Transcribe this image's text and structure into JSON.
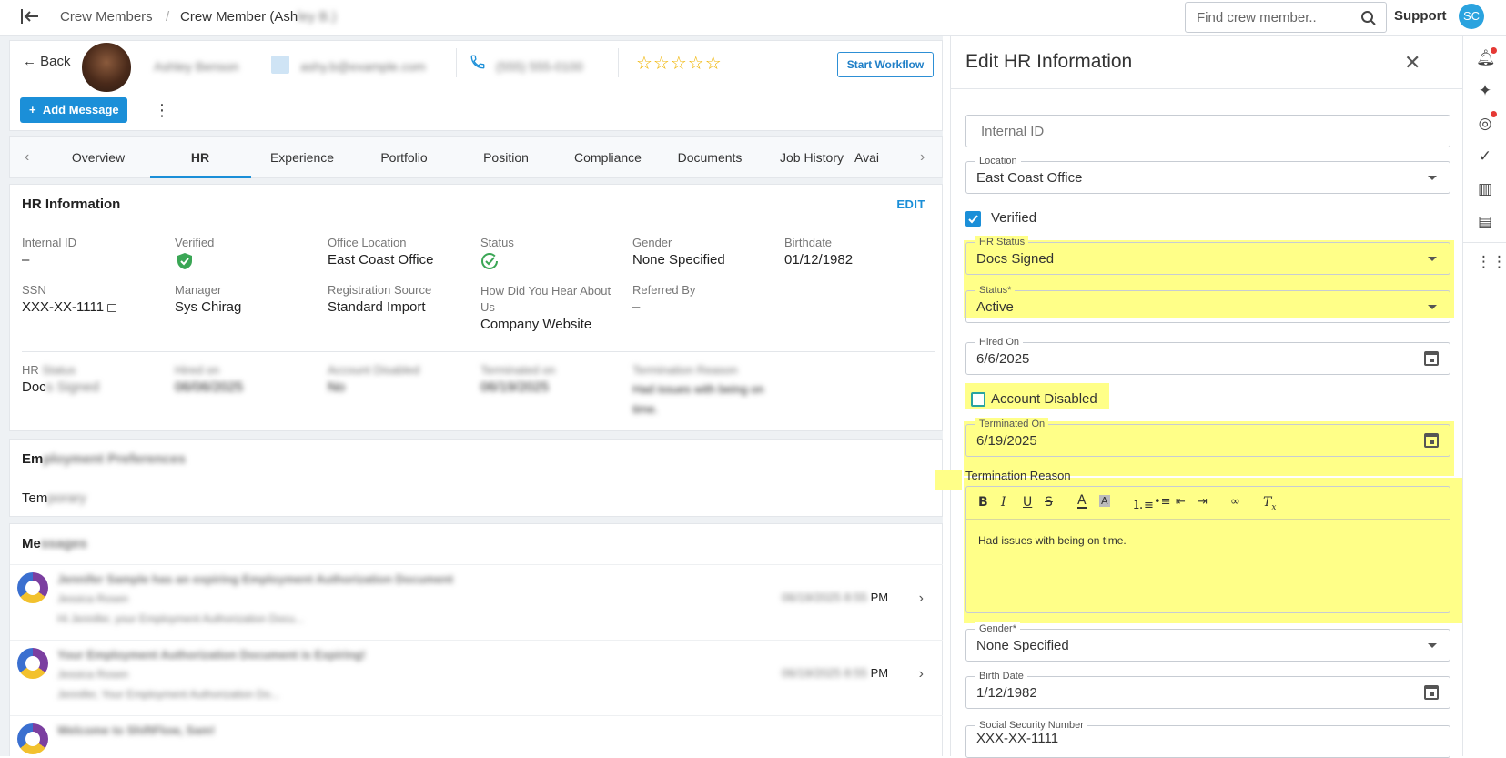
{
  "topbar": {
    "crumb_root": "Crew Members",
    "crumb_sep": "/",
    "crumb_current": "Crew Member (Ash",
    "crumb_current_blur": "ley B.)",
    "search_placeholder": "Find crew member..",
    "support": "Support",
    "user_initials": "SC"
  },
  "header": {
    "back": "Back",
    "name": "Ashley Benson",
    "email": "ashy.b@example.com",
    "phone": "(555) 555-0100",
    "stars": "☆☆☆☆☆",
    "start_workflow": "Start Workflow",
    "add_message": "Add Message",
    "more": "⋮"
  },
  "tabs": [
    "Overview",
    "HR",
    "Experience",
    "Portfolio",
    "Position",
    "Compliance",
    "Documents",
    "Job History",
    "Avai"
  ],
  "hr": {
    "title": "HR Information",
    "edit": "EDIT",
    "internal_id_label": "Internal ID",
    "internal_id": "–",
    "verified_label": "Verified",
    "office_label": "Office Location",
    "office": "East Coast Office",
    "status_label": "Status",
    "gender_label": "Gender",
    "gender": "None Specified",
    "birthdate_label": "Birthdate",
    "birthdate": "01/12/1982",
    "ssn_label": "SSN",
    "ssn": "XXX-XX-1111",
    "manager_label": "Manager",
    "manager": "Sys Chirag",
    "reg_label": "Registration Source",
    "reg": "Standard Import",
    "hear_label": "How Did You Hear About Us",
    "hear": "Company Website",
    "referred_label": "Referred By",
    "referred": "–",
    "hr_status_label": "HR",
    "hr_status_label_blur": "Status",
    "hr_status_value": "Doc",
    "hr_status_value_blur": "s Signed",
    "hired_label": "Hired on",
    "hired": "06/06/2025",
    "disabled_label": "Account Disabled",
    "disabled": "No",
    "term_label": "Terminated on",
    "term": "06/19/2025",
    "reason_label": "Termination Reason",
    "reason": "Had issues with being on time."
  },
  "employment": {
    "title": "Em",
    "title_blur": "ployment Preferences",
    "value": "Tem",
    "value_blur": "porary"
  },
  "messages": {
    "title": "Me",
    "title_blur": "ssages",
    "items": [
      {
        "subject": "Jennifer Sample has an expiring Employment Authorization Document",
        "from": "Jessica Rosen",
        "preview": "Hi Jennifer, your Employment Authorization Docu...",
        "time": "06/19/2025 8:55 ",
        "time_ampm": "PM"
      },
      {
        "subject": "Your Employment Authorization Document is Expiring!",
        "from": "Jessica Rosen",
        "preview": "Jennifer, Your Employment Authorization Do...",
        "time": "06/19/2025 8:55 ",
        "time_ampm": "PM"
      },
      {
        "subject": "Welcome to ShiftFlow, Sam!",
        "from": "",
        "preview": "",
        "time": "",
        "time_ampm": ""
      }
    ]
  },
  "panel": {
    "title": "Edit HR Information",
    "internal_id_placeholder": "Internal ID",
    "location_label": "Location",
    "location": "East Coast Office",
    "verified": "Verified",
    "hr_status_label": "HR Status",
    "hr_status": "Docs Signed",
    "status_label": "Status*",
    "status": "Active",
    "hired_label": "Hired On",
    "hired": "6/6/2025",
    "account_disabled": "Account Disabled",
    "terminated_label": "Terminated On",
    "terminated": "6/19/2025",
    "reason_label": "Termination Reason",
    "reason": "Had issues with being on time.",
    "gender_label": "Gender*",
    "gender": "None Specified",
    "birth_label": "Birth Date",
    "birth": "1/12/1982",
    "ssn_label": "Social Security Number",
    "ssn": "XXX-XX-1111"
  },
  "colors": {
    "accent": "#1b8fd8",
    "highlight": "#ffff88",
    "star": "#f0b400"
  }
}
